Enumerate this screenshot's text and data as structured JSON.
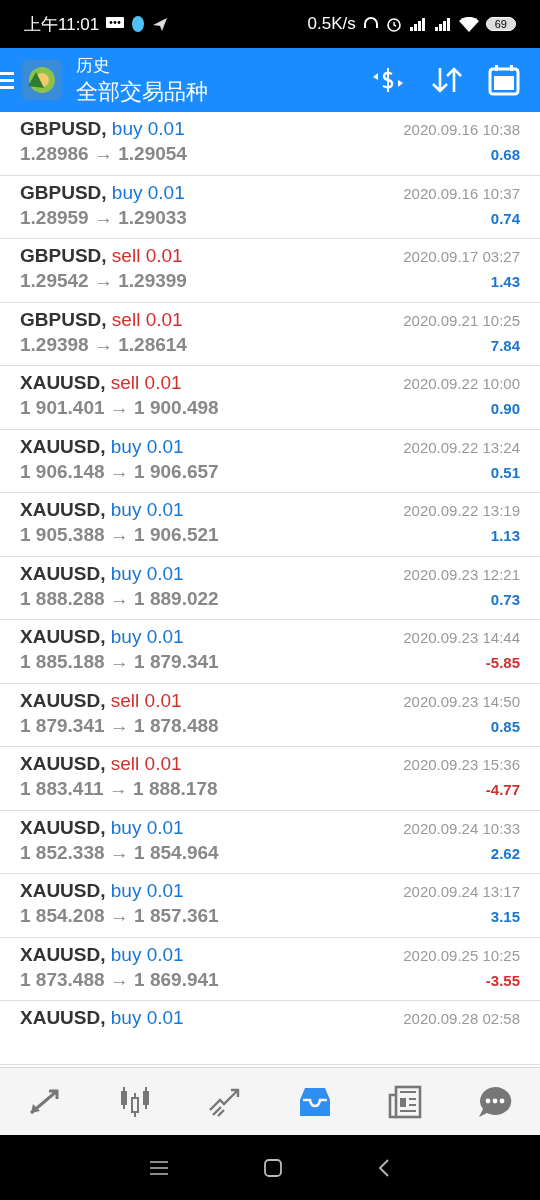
{
  "status_bar": {
    "time": "上午11:01",
    "speed": "0.5K/s",
    "battery": "69"
  },
  "header": {
    "subtitle": "历史",
    "title": "全部交易品种"
  },
  "rows": [
    {
      "symbol": "GBPUSD,",
      "side": "buy",
      "volume": "0.01",
      "prices": "1.28986 → 1.29054",
      "time": "2020.09.16 10:38",
      "profit": "0.68",
      "loss": false
    },
    {
      "symbol": "GBPUSD,",
      "side": "buy",
      "volume": "0.01",
      "prices": "1.28959 → 1.29033",
      "time": "2020.09.16 10:37",
      "profit": "0.74",
      "loss": false
    },
    {
      "symbol": "GBPUSD,",
      "side": "sell",
      "volume": "0.01",
      "prices": "1.29542 → 1.29399",
      "time": "2020.09.17 03:27",
      "profit": "1.43",
      "loss": false
    },
    {
      "symbol": "GBPUSD,",
      "side": "sell",
      "volume": "0.01",
      "prices": "1.29398 → 1.28614",
      "time": "2020.09.21 10:25",
      "profit": "7.84",
      "loss": false
    },
    {
      "symbol": "XAUUSD,",
      "side": "sell",
      "volume": "0.01",
      "prices": "1 901.401 → 1 900.498",
      "time": "2020.09.22 10:00",
      "profit": "0.90",
      "loss": false
    },
    {
      "symbol": "XAUUSD,",
      "side": "buy",
      "volume": "0.01",
      "prices": "1 906.148 → 1 906.657",
      "time": "2020.09.22 13:24",
      "profit": "0.51",
      "loss": false
    },
    {
      "symbol": "XAUUSD,",
      "side": "buy",
      "volume": "0.01",
      "prices": "1 905.388 → 1 906.521",
      "time": "2020.09.22 13:19",
      "profit": "1.13",
      "loss": false
    },
    {
      "symbol": "XAUUSD,",
      "side": "buy",
      "volume": "0.01",
      "prices": "1 888.288 → 1 889.022",
      "time": "2020.09.23 12:21",
      "profit": "0.73",
      "loss": false
    },
    {
      "symbol": "XAUUSD,",
      "side": "buy",
      "volume": "0.01",
      "prices": "1 885.188 → 1 879.341",
      "time": "2020.09.23 14:44",
      "profit": "-5.85",
      "loss": true
    },
    {
      "symbol": "XAUUSD,",
      "side": "sell",
      "volume": "0.01",
      "prices": "1 879.341 → 1 878.488",
      "time": "2020.09.23 14:50",
      "profit": "0.85",
      "loss": false
    },
    {
      "symbol": "XAUUSD,",
      "side": "sell",
      "volume": "0.01",
      "prices": "1 883.411 → 1 888.178",
      "time": "2020.09.23 15:36",
      "profit": "-4.77",
      "loss": true
    },
    {
      "symbol": "XAUUSD,",
      "side": "buy",
      "volume": "0.01",
      "prices": "1 852.338 → 1 854.964",
      "time": "2020.09.24 10:33",
      "profit": "2.62",
      "loss": false
    },
    {
      "symbol": "XAUUSD,",
      "side": "buy",
      "volume": "0.01",
      "prices": "1 854.208 → 1 857.361",
      "time": "2020.09.24 13:17",
      "profit": "3.15",
      "loss": false
    },
    {
      "symbol": "XAUUSD,",
      "side": "buy",
      "volume": "0.01",
      "prices": "1 873.488 → 1 869.941",
      "time": "2020.09.25 10:25",
      "profit": "-3.55",
      "loss": true
    },
    {
      "symbol": "XAUUSD,",
      "side": "buy",
      "volume": "0.01",
      "time": "2020.09.28 02:58"
    }
  ],
  "nav": [
    {
      "kind": "trade",
      "selected": false
    },
    {
      "kind": "quotes",
      "selected": false
    },
    {
      "kind": "chart",
      "selected": false
    },
    {
      "kind": "history",
      "selected": true
    },
    {
      "kind": "news",
      "selected": false
    },
    {
      "kind": "chat",
      "selected": false
    }
  ]
}
